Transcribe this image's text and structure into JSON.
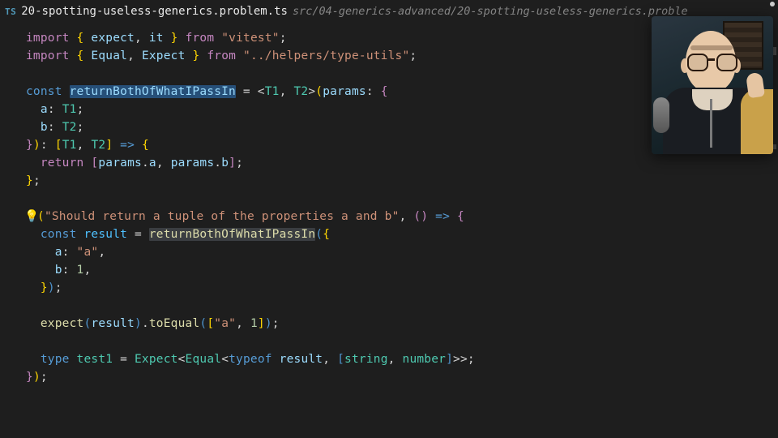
{
  "tab": {
    "icon": "TS",
    "filename": "20-spotting-useless-generics.problem.ts",
    "path": "src/04-generics-advanced/20-spotting-useless-generics.proble"
  },
  "code": {
    "l1": {
      "import": "import",
      "lb": "{ ",
      "e": "expect",
      "c1": ", ",
      "i": "it",
      "rb": " }",
      "from": "from",
      "s": "\"vitest\""
    },
    "l2": {
      "import": "import",
      "lb": "{ ",
      "e": "Equal",
      "c1": ", ",
      "x": "Expect",
      "rb": " }",
      "from": "from",
      "s": "\"../helpers/type-utils\""
    },
    "l4": {
      "const": "const",
      "name": "returnBothOfWhatIPassIn",
      "eq": " = ",
      "lt": "<",
      "t1": "T1",
      "c": ", ",
      "t2": "T2",
      "gt": ">",
      "lp": "(",
      "params": "params",
      "colon": ": ",
      "lb": "{"
    },
    "l5": {
      "a": "a",
      "c": ": ",
      "t": "T1",
      "sc": ";"
    },
    "l6": {
      "b": "b",
      "c": ": ",
      "t": "T2",
      "sc": ";"
    },
    "l7": {
      "rb": "}",
      "rp": ")",
      "colon": ": ",
      "lb": "[",
      "t1": "T1",
      "c": ", ",
      "t2": "T2",
      "rbk": "]",
      "arrow": " => ",
      "lcb": "{"
    },
    "l8": {
      "ret": "return",
      "lb": " [",
      "p1": "params",
      "d1": ".",
      "a": "a",
      "c": ", ",
      "p2": "params",
      "d2": ".",
      "b": "b",
      "rb": "]",
      "sc": ";"
    },
    "l9": {
      "rb": "}",
      "sc": ";"
    },
    "l11": {
      "it": "it",
      "lp": "(",
      "s": "\"Should return a tuple of the properties a and b\"",
      "c": ", ",
      "lp2": "(",
      "rp2": ")",
      "arrow": " => ",
      "lb": "{"
    },
    "l12": {
      "const": "const",
      "r": "result",
      "eq": " = ",
      "fn": "returnBothOfWhatIPassIn",
      "lp": "(",
      "lb": "{"
    },
    "l13": {
      "a": "a",
      "c": ": ",
      "v": "\"a\"",
      "cm": ","
    },
    "l14": {
      "b": "b",
      "c": ": ",
      "v": "1",
      "cm": ","
    },
    "l15": {
      "rb": "}",
      "rp": ")",
      "sc": ";"
    },
    "l17": {
      "e": "expect",
      "lp": "(",
      "r": "result",
      "rp": ")",
      "d": ".",
      "te": "toEqual",
      "lp2": "(",
      "lb": "[",
      "s": "\"a\"",
      "c": ", ",
      "n": "1",
      "rb": "]",
      "rp2": ")",
      "sc": ";"
    },
    "l19": {
      "type": "type",
      "t": "test1",
      "eq": " = ",
      "ex": "Expect",
      "lt": "<",
      "eq2": "Equal",
      "lt2": "<",
      "to": "typeof",
      "r": " result",
      "c": ", ",
      "lb": "[",
      "st": "string",
      "c2": ", ",
      "nu": "number",
      "rb": "]",
      "gt2": ">",
      "gt": ">",
      "sc": ";"
    },
    "l20": {
      "rb": "}",
      "rp": ")",
      "sc": ";"
    }
  },
  "icons": {
    "bulb": "💡"
  }
}
